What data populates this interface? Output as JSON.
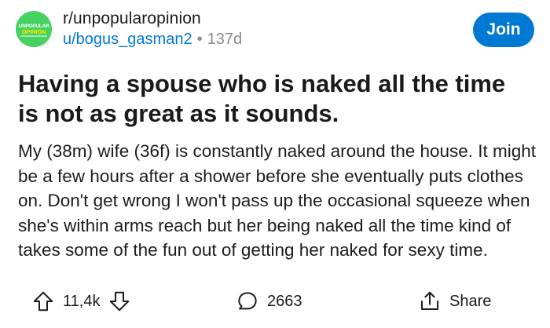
{
  "post_header": {
    "subreddit": "r/unpopularopinion",
    "username": "u/bogus_gasman2",
    "separator": "•",
    "age": "137d",
    "join_label": "Join",
    "logo_text": "UNPOPULAR OPINION",
    "logo_color": "#46d160"
  },
  "post": {
    "title": "Having a spouse who is naked all the time is not as great as it sounds.",
    "body": "My (38m) wife (36f) is constantly naked around the house.  It might be a few hours after a shower before she eventually puts clothes on.  Don't get wrong I won't pass up the occasional squeeze when she's within arms reach but her being naked all the time kind of takes some of the fun out of getting her naked for sexy time."
  },
  "actions": {
    "vote_count": "11,4k",
    "comment_count": "2663",
    "share_label": "Share"
  },
  "icons": {
    "upvote": "upvote-arrow-icon",
    "downvote": "downvote-arrow-icon",
    "comment": "speech-bubble-icon",
    "share": "share-upload-icon"
  },
  "colors": {
    "accent": "#0079d3",
    "muted": "#878a8c",
    "text": "#1a1a1b"
  }
}
